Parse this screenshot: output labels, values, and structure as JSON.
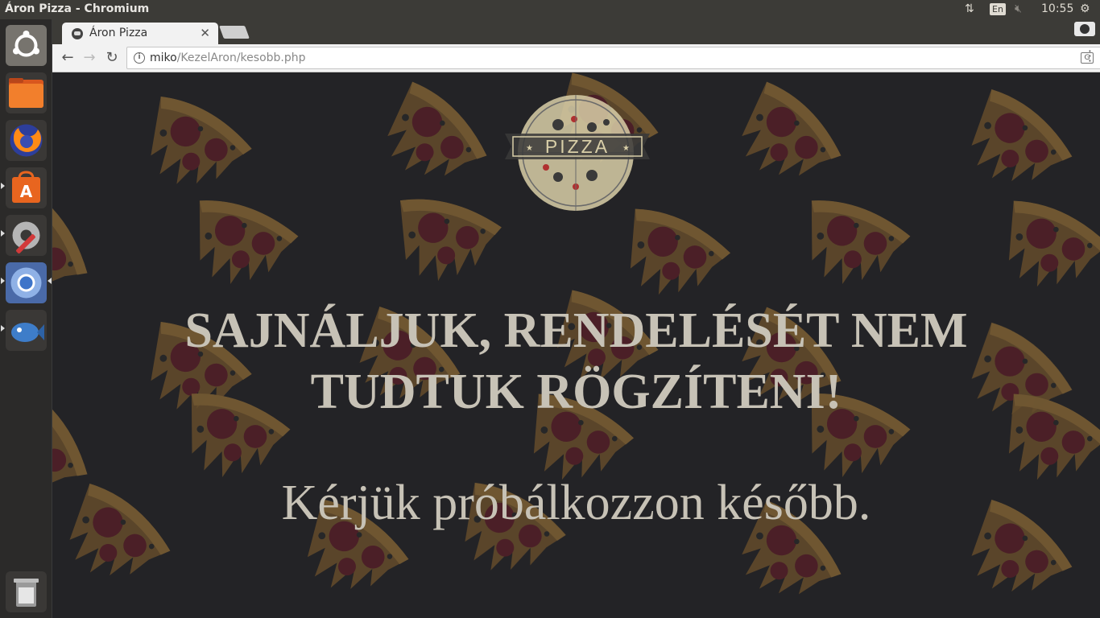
{
  "system": {
    "window_title": "Áron Pizza - Chromium",
    "lang": "En",
    "clock": "10:55"
  },
  "launcher": {
    "items": [
      "ubuntu-dash",
      "files",
      "firefox",
      "software-center",
      "system-settings",
      "chromium",
      "shotwell",
      "trash"
    ]
  },
  "browser": {
    "tab_title": "Áron Pizza",
    "url_host": "miko",
    "url_path": "/KezelAron/kesobb.php"
  },
  "page": {
    "logo_text": "PIZZA",
    "headline_line1": "SAJNÁLJUK, RENDELÉSÉT NEM",
    "headline_line2": "TUDTUK RÖGZÍTENI!",
    "subtext": "Kérjük próbálkozzon később."
  },
  "colors": {
    "page_bg": "#232326",
    "text": "#c7c2b6",
    "pizza_crust": "#7a5a2e",
    "pepperoni": "#5a1f28"
  }
}
